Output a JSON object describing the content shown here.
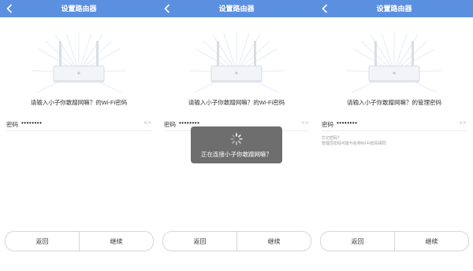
{
  "colors": {
    "topbar": "#5b8fe0",
    "toast_bg": "#5a5a5a"
  },
  "screens": [
    {
      "title": "设置路由器",
      "prompt": "请输入小子你敢蹭网嘛？的Wi-Fi密码",
      "password_label": "密码",
      "password_value": "••••••••",
      "visibility_toggle": "<>",
      "buttons": {
        "back": "返回",
        "continue": "继续"
      }
    },
    {
      "title": "设置路由器",
      "prompt": "请输入小子你敢蹭网嘛？的Wi-Fi密码",
      "password_label": "密码",
      "password_value": "••••••••",
      "visibility_toggle": "<>",
      "buttons": {
        "back": "返回",
        "continue": "继续"
      },
      "toast": {
        "icon": "loading-spinner-icon",
        "text": "正在连接小子你敢蹭网嘛？"
      }
    },
    {
      "title": "设置路由器",
      "prompt": "请输入小子你敢蹭网嘛？的管理密码",
      "password_label": "密码",
      "password_value": "••••••••",
      "visibility_toggle": "<>",
      "hint": {
        "line1": "忘记密码？",
        "line2": "管理员密码可能与名称Wi-Fi密码相同"
      },
      "buttons": {
        "back": "返回",
        "continue": "继续"
      }
    }
  ]
}
